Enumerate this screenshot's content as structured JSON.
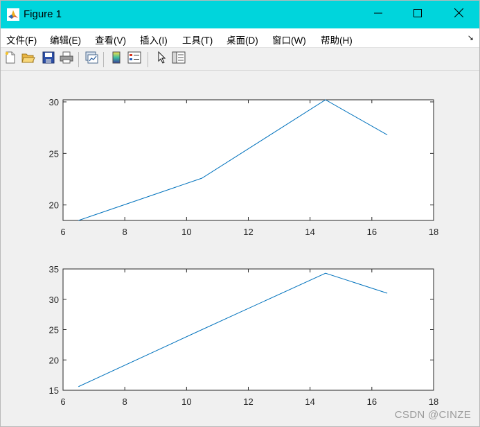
{
  "window": {
    "title": "Figure 1",
    "titlebar_color": "#00d5dc",
    "controls": {
      "minimize": "minimize-icon",
      "maximize": "maximize-icon",
      "close": "close-icon"
    }
  },
  "menu": {
    "items": [
      {
        "label": "文件(F)",
        "key": "file"
      },
      {
        "label": "编辑(E)",
        "key": "edit"
      },
      {
        "label": "查看(V)",
        "key": "view"
      },
      {
        "label": "插入(I)",
        "key": "insert"
      },
      {
        "label": "工具(T)",
        "key": "tools"
      },
      {
        "label": "桌面(D)",
        "key": "desktop"
      },
      {
        "label": "窗口(W)",
        "key": "window"
      },
      {
        "label": "帮助(H)",
        "key": "help"
      }
    ],
    "dock_arrow": "↘"
  },
  "toolbar": {
    "tools": [
      "new-figure-icon",
      "open-file-icon",
      "save-icon",
      "print-icon",
      "link-plot-icon",
      "insert-colorbar-icon",
      "insert-legend-icon",
      "edit-plot-arrow-icon",
      "property-inspector-icon"
    ]
  },
  "watermark": "CSDN @CINZE",
  "chart_data": [
    {
      "type": "line",
      "x": [
        6.5,
        10.5,
        14.5,
        16.5
      ],
      "y": [
        18.5,
        22.6,
        30.2,
        26.8
      ],
      "xlim": [
        6,
        18
      ],
      "ylim": [
        18.5,
        30.2
      ],
      "xticks": [
        6,
        8,
        10,
        12,
        14,
        16,
        18
      ],
      "yticks": [
        20,
        25,
        30
      ],
      "line_color": "#0072bd",
      "grid": false,
      "title": "",
      "xlabel": "",
      "ylabel": ""
    },
    {
      "type": "line",
      "x": [
        6.5,
        10.5,
        14.5,
        16.5
      ],
      "y": [
        15.6,
        25,
        34.3,
        31
      ],
      "xlim": [
        6,
        18
      ],
      "ylim": [
        15,
        35
      ],
      "xticks": [
        6,
        8,
        10,
        12,
        14,
        16,
        18
      ],
      "yticks": [
        15,
        20,
        25,
        30,
        35
      ],
      "line_color": "#0072bd",
      "grid": false,
      "title": "",
      "xlabel": "",
      "ylabel": ""
    }
  ]
}
